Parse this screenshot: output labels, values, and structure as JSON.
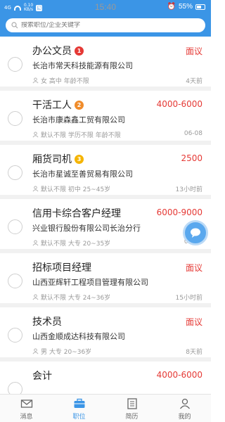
{
  "status": {
    "time": "15:40",
    "signal": "4G",
    "speed_value": "0.10",
    "speed_unit": "KB/s",
    "battery": "55%"
  },
  "search": {
    "placeholder": "搜索职位/企业关键字"
  },
  "jobs": [
    {
      "title": "办公文员",
      "rank": "1",
      "salary": "面议",
      "company": "长治市常天科技能源有限公司",
      "meta": "女 高中 年龄不限",
      "time": "4天前",
      "medal_color": "#e53935"
    },
    {
      "title": "干活工人",
      "rank": "2",
      "salary": "4000-6000",
      "company": "长治市康森鑫工贸有限公司",
      "meta": "默认不限 学历不限 年龄不限",
      "time": "06-08",
      "medal_color": "#f08c2b"
    },
    {
      "title": "厢货司机",
      "rank": "3",
      "salary": "2500",
      "company": "长治市星诚至善贸易有限公司",
      "meta": "默认不限 初中 25~45岁",
      "time": "13小时前",
      "medal_color": "#f5b400"
    },
    {
      "title": "信用卡综合客户经理",
      "rank": "",
      "salary": "6000-9000",
      "company": "兴业银行股份有限公司长治分行",
      "meta": "默认不限 大专 20~35岁",
      "time": "08-19",
      "medal_color": ""
    },
    {
      "title": "招标项目经理",
      "rank": "",
      "salary": "面议",
      "company": "山西亚辉轩工程项目管理有限公司",
      "meta": "默认不限 大专 24~36岁",
      "time": "15小时前",
      "medal_color": ""
    },
    {
      "title": "技术员",
      "rank": "",
      "salary": "面议",
      "company": "山西金顺成达科技有限公司",
      "meta": "男 大专 20~36岁",
      "time": "8天前",
      "medal_color": ""
    },
    {
      "title": "会计",
      "rank": "",
      "salary": "4000-6000",
      "company": "",
      "meta": "",
      "time": "",
      "medal_color": ""
    }
  ],
  "tabs": [
    {
      "label": "消息",
      "icon": "mail-icon"
    },
    {
      "label": "职位",
      "icon": "briefcase-icon",
      "active": true
    },
    {
      "label": "简历",
      "icon": "resume-icon"
    },
    {
      "label": "我的",
      "icon": "profile-icon"
    }
  ],
  "colors": {
    "primary": "#3b95e6",
    "salary": "#e53935"
  }
}
